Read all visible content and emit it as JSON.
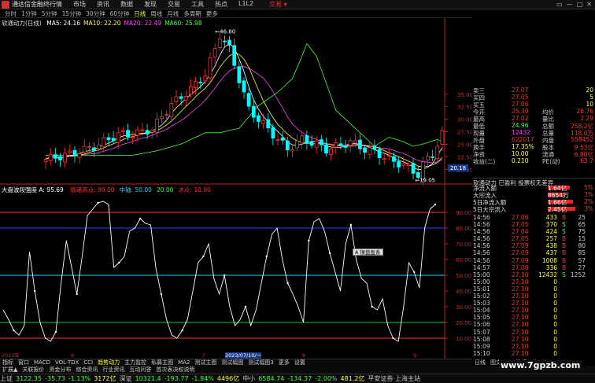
{
  "titlebar": {
    "app_name": "通达信金融终端",
    "menu": [
      "行情",
      "市场",
      "资讯",
      "数据",
      "发现",
      "交易",
      "工具",
      "热点",
      "L1L2"
    ],
    "account": "交易 ▾",
    "window_buttons": [
      "▭",
      "—",
      "□",
      "✕"
    ]
  },
  "toolbar": {
    "periods": [
      "分时",
      "1分钟",
      "5分钟",
      "15分钟",
      "30分钟",
      "60分钟",
      "日线",
      "周线",
      "月线",
      "多周期",
      "更多"
    ],
    "active": "日线"
  },
  "kline": {
    "title": "软通动力(日线)",
    "ma_labels": [
      {
        "text": "MA5: 24.16",
        "color": "#ffffff"
      },
      {
        "text": "MA10: 22.20",
        "color": "#ffff44"
      },
      {
        "text": "MA20: 22.49",
        "color": "#ff44ff"
      },
      {
        "text": "MA60: 25.98",
        "color": "#44ff44"
      }
    ],
    "high_label": "46.80",
    "low_label": "19.05",
    "price_scale": [
      "35.00",
      "32.50",
      "30.00",
      "27.50",
      "25.00",
      "22.50",
      "20.00"
    ],
    "cursor_price": "20.18",
    "colors": {
      "up": "#ff3333",
      "down": "#00ffff",
      "ma5": "#ffffff",
      "ma10": "#ffff44",
      "ma20": "#ff44ff",
      "ma60": "#44ff44"
    }
  },
  "osc": {
    "title": "大盘波段强度 A: 95.69",
    "legend": [
      {
        "text": "情绪高点: 90.00",
        "color": "#ff3333"
      },
      {
        "text": "中轴: 50.00",
        "color": "#44ccff"
      },
      {
        "text": "20.00",
        "color": "#44ff44"
      },
      {
        "text": "冰点: 10.00",
        "color": "#ff3333"
      }
    ],
    "scale": [
      "90.00",
      "80.00",
      "70.00",
      "60.00",
      "50.00",
      "40.00",
      "30.00",
      "20.00",
      "10.00"
    ],
    "date_labels": [
      "2023年",
      "6",
      "7",
      "2023/07/10/一",
      "8",
      "9"
    ]
  },
  "chart_data": {
    "type": "line",
    "series": [
      {
        "name": "A",
        "values": [
          28,
          22,
          15,
          12,
          18,
          65,
          40,
          20,
          10,
          8,
          14,
          45,
          72,
          55,
          38,
          62,
          88,
          92,
          96,
          97,
          95,
          55,
          58,
          62,
          78,
          80,
          86,
          83,
          82,
          54,
          38,
          22,
          12,
          10,
          15,
          22,
          40,
          58,
          62,
          70,
          48,
          38,
          50,
          30,
          18,
          22,
          30,
          18,
          28,
          45,
          62,
          76,
          80,
          60,
          45,
          38,
          30,
          20,
          72,
          84,
          86,
          78,
          64,
          52,
          40,
          70,
          82,
          60,
          48,
          45,
          30,
          28,
          35,
          18,
          10,
          8,
          30,
          58,
          52,
          42,
          80,
          92,
          95
        ]
      }
    ]
  },
  "quote": {
    "rows": [
      {
        "label": "卖三",
        "value": "27.07",
        "vol": "20",
        "valcolor": "#ff3333"
      },
      {
        "label": "买四",
        "value": "27.05",
        "vol": "5",
        "valcolor": "#ff3333"
      },
      {
        "label": "买五",
        "value": "27.06",
        "vol": "10",
        "valcolor": "#ff3333"
      },
      {
        "label": "今开",
        "value": "25.30",
        "label2": "均价",
        "value2": "26.76",
        "valcolor": "#ff3333"
      },
      {
        "label": "最高",
        "value": "27.02",
        "label2": "量比",
        "value2": "2.29",
        "valcolor": "#ff3333"
      },
      {
        "label": "最低",
        "value": "24.96",
        "label2": "总额",
        "value2": "258.2亿",
        "valcolor": "#44ff44"
      },
      {
        "label": "现量",
        "value": "12432",
        "label2": "总量",
        "value2": "118.0万",
        "valcolor": "#ff44ff"
      },
      {
        "label": "外盘",
        "value": "622017",
        "label2": "内盘",
        "value2": "558452",
        "valcolor": "#ff3333"
      },
      {
        "label": "换手",
        "value": "17.35%",
        "label2": "股本",
        "value2": "9.53亿",
        "valcolor": "#ffff44"
      },
      {
        "label": "净资",
        "value": "10.00",
        "label2": "流通",
        "value2": "6.80亿",
        "valcolor": "#ffff44"
      },
      {
        "label": "收益(二)",
        "value": "0.210",
        "label2": "PE(动)",
        "value2": "63.7",
        "valcolor": "#ffff44"
      }
    ]
  },
  "flow": {
    "title": "软通动力 已盈利 投票权无差异",
    "rows": [
      {
        "label": "净流入额",
        "value": "1.64亿",
        "pct": "5%",
        "bar": 40
      },
      {
        "label": "大宗流入",
        "value": "8654万",
        "pct": "3%",
        "bar": 30
      },
      {
        "label": "5日净流入额",
        "value": "1.66亿",
        "pct": "2%",
        "bar": 45
      },
      {
        "label": "5日大宗流入",
        "value": "2.45亿",
        "pct": "3%",
        "bar": 50
      }
    ]
  },
  "ticks": [
    {
      "time": "14:56",
      "price": "27.06",
      "vol": "433",
      "side": "B",
      "count": "25"
    },
    {
      "time": "14:56",
      "price": "27.05",
      "vol": "370",
      "side": "S",
      "count": "65"
    },
    {
      "time": "14:56",
      "price": "27.04",
      "vol": "424",
      "side": "S",
      "count": "75"
    },
    {
      "time": "14:56",
      "price": "27.05",
      "vol": "257",
      "side": "B",
      "count": "15"
    },
    {
      "time": "14:56",
      "price": "27.09",
      "vol": "438",
      "side": "B",
      "count": "80"
    },
    {
      "time": "14:56",
      "price": "27.09",
      "vol": "437",
      "side": "B",
      "count": "85"
    },
    {
      "time": "14:56",
      "price": "27.09",
      "vol": "1008",
      "side": "B",
      "count": "57"
    },
    {
      "time": "14:57",
      "price": "27.08",
      "vol": "336",
      "side": "B",
      "count": "27"
    },
    {
      "time": "15:00",
      "price": "27.10",
      "vol": "12432",
      "side": "S",
      "count": "1252"
    },
    {
      "time": "15:00",
      "price": "27.10",
      "vol": "0",
      "side": "",
      "count": ""
    },
    {
      "time": "15:01",
      "price": "27.10",
      "vol": "0",
      "side": "",
      "count": ""
    },
    {
      "time": "15:02",
      "price": "27.10",
      "vol": "0",
      "side": "",
      "count": ""
    },
    {
      "time": "15:03",
      "price": "27.10",
      "vol": "0",
      "side": "",
      "count": ""
    },
    {
      "time": "15:04",
      "price": "27.10",
      "vol": "0",
      "side": "",
      "count": ""
    },
    {
      "time": "15:05",
      "price": "27.10",
      "vol": "0",
      "side": "",
      "count": ""
    },
    {
      "time": "15:06",
      "price": "27.10",
      "vol": "0",
      "side": "",
      "count": ""
    },
    {
      "time": "15:07",
      "price": "27.10",
      "vol": "0",
      "side": "",
      "count": ""
    },
    {
      "time": "15:08",
      "price": "27.10",
      "vol": "0",
      "side": "",
      "count": ""
    },
    {
      "time": "15:09",
      "price": "27.10",
      "vol": "0",
      "side": "",
      "count": ""
    },
    {
      "time": "15:10",
      "price": "27.10",
      "vol": "0",
      "side": "",
      "count": ""
    }
  ],
  "bottom_tabs": [
    "指标",
    "窗口",
    "MACD",
    "VOL-TDX",
    "CCI",
    "趋势动力",
    "主力监控",
    "私募主图",
    "MA2",
    "测试主图",
    "测试幅图",
    "测试幅图3",
    "更多",
    "设置"
  ],
  "bottom_tabs2": [
    "扩展▲",
    "关联报价",
    "资金分布",
    "综合资讯",
    "行业资讯",
    "互动问答",
    "首次表决权说明"
  ],
  "side_tabs": [
    "日线",
    "图文F10",
    "数据",
    "笔",
    "价"
  ],
  "popup_label": "A 操盘盈系",
  "statusbar": {
    "items": [
      {
        "text": "上证",
        "color": "#ccc"
      },
      {
        "text": "3122.35",
        "color": "#44ff44"
      },
      {
        "text": "-35.73",
        "color": "#44ff44"
      },
      {
        "text": "-1.13%",
        "color": "#44ff44"
      },
      {
        "text": "3172亿",
        "color": "#ffff44"
      },
      {
        "text": "深证",
        "color": "#ccc"
      },
      {
        "text": "10321.4",
        "color": "#44ff44"
      },
      {
        "text": "-193.77",
        "color": "#44ff44"
      },
      {
        "text": "-1.84%",
        "color": "#44ff44"
      },
      {
        "text": "4496亿",
        "color": "#ffff44"
      },
      {
        "text": "中小",
        "color": "#ccc"
      },
      {
        "text": "6584.74",
        "color": "#44ff44"
      },
      {
        "text": "-134.37",
        "color": "#44ff44"
      },
      {
        "text": "-2.00%",
        "color": "#44ff44"
      },
      {
        "text": "481.2亿",
        "color": "#ffff44"
      },
      {
        "text": "平安证券·上海主站",
        "color": "#ccc"
      }
    ]
  },
  "watermark": "www.7gpzb.com"
}
